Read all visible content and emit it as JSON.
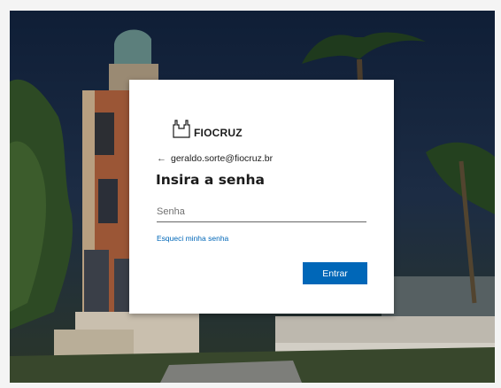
{
  "page": {
    "background": "#f4f4f4",
    "accent": "#0067b8"
  },
  "brand": {
    "name": "FIOCRUZ",
    "icon": "fiocruz-castle-icon"
  },
  "signin": {
    "back_icon": "arrow-left-icon",
    "account": "geraldo.sorte@fiocruz.br",
    "title": "Insira a senha",
    "password_placeholder": "Senha",
    "password_value": "",
    "forgot_link": "Esqueci minha senha",
    "submit_label": "Entrar"
  }
}
